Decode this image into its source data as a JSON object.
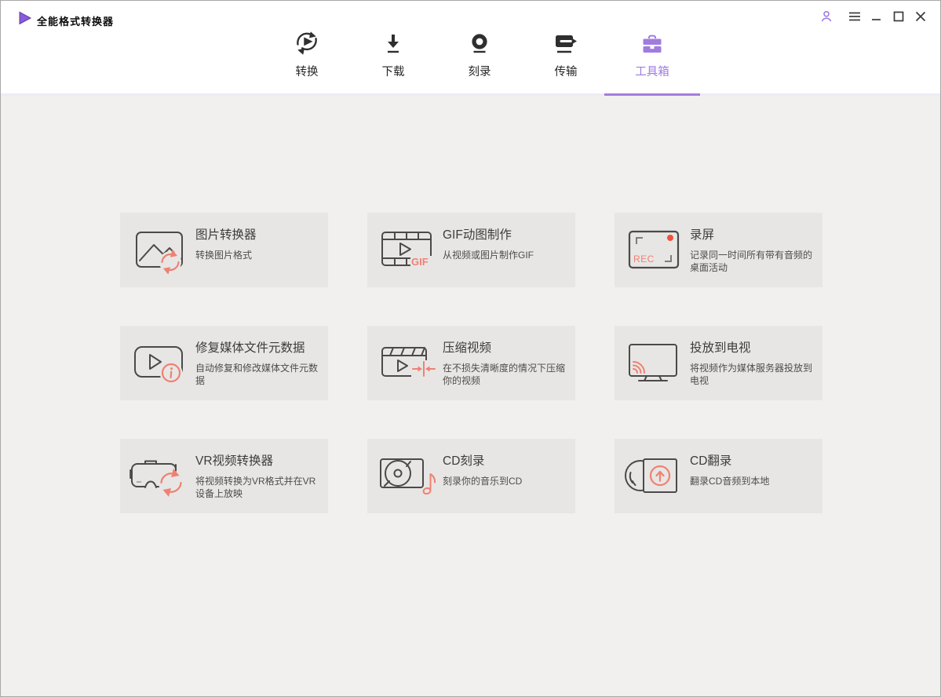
{
  "window": {
    "title": "全能格式转换器"
  },
  "nav": {
    "active_tab": "工具箱",
    "tabs": [
      {
        "label": "转换",
        "icon": "convert-icon",
        "active": false
      },
      {
        "label": "下载",
        "icon": "download-icon",
        "active": false
      },
      {
        "label": "刻录",
        "icon": "burn-icon",
        "active": false
      },
      {
        "label": "传输",
        "icon": "transfer-icon",
        "active": false
      },
      {
        "label": "工具箱",
        "icon": "toolbox-icon",
        "active": true
      }
    ]
  },
  "toolbox": {
    "cards": [
      {
        "title": "图片转换器",
        "desc": "转换图片格式",
        "icon": "image-converter-icon"
      },
      {
        "title": "GIF动图制作",
        "desc": "从视频或图片制作GIF",
        "icon": "gif-maker-icon",
        "icon_label": "GIF"
      },
      {
        "title": "录屏",
        "desc": "记录同一时间所有带有音频的桌面活动",
        "icon": "screen-record-icon",
        "icon_label": "REC"
      },
      {
        "title": "修复媒体文件元数据",
        "desc": "自动修复和修改媒体文件元数据",
        "icon": "fix-metadata-icon"
      },
      {
        "title": "压缩视频",
        "desc": "在不损失清晰度的情况下压缩你的视频",
        "icon": "compress-video-icon"
      },
      {
        "title": "投放到电视",
        "desc": "将视频作为媒体服务器投放到电视",
        "icon": "cast-to-tv-icon"
      },
      {
        "title": "VR视频转换器",
        "desc": "将视频转换为VR格式并在VR设备上放映",
        "icon": "vr-converter-icon"
      },
      {
        "title": "CD刻录",
        "desc": "刻录你的音乐到CD",
        "icon": "cd-burn-icon"
      },
      {
        "title": "CD翻录",
        "desc": "翻录CD音频到本地",
        "icon": "cd-rip-icon"
      }
    ]
  },
  "colors": {
    "accent_purple": "#a07ce0",
    "accent_coral": "#ef8173",
    "record_red": "#f2503e",
    "card_bg": "#e7e6e4",
    "content_bg": "#f1f0ef"
  }
}
